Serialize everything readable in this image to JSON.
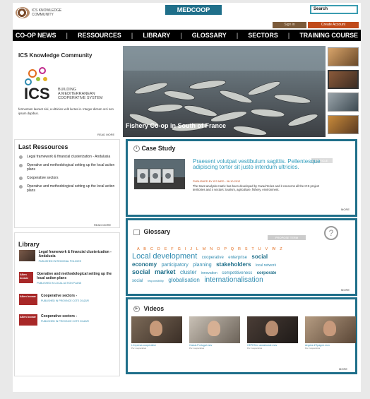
{
  "header": {
    "logo_text": "ICS KNOWLEDGE COMMUNITY",
    "brand_tab": "MEDCOOP",
    "search_label": "Search",
    "sign_in": "Sign in",
    "create_account": "Create Account"
  },
  "nav": [
    {
      "label": "CO-OP NEWS"
    },
    {
      "label": "RESSOURCES"
    },
    {
      "label": "LIBRARY"
    },
    {
      "label": "GLOSSARY"
    },
    {
      "label": "SECTORS"
    },
    {
      "label": "TRAINING COURSE"
    }
  ],
  "ics": {
    "title": "ICS Knowledge Community",
    "tagline_1": "BUILDING",
    "tagline_2": "A MEDITERRANEAN",
    "tagline_3": "COOPERATIVE SYSTEM",
    "body": "fermentum laoreet nisi, a ultricies velit luctus in. Integer dictum orci non ipsum dapibus.",
    "read_more": "READ MORE"
  },
  "hero": {
    "caption": "Fishery Co-op in South of France"
  },
  "resources": {
    "title": "Last Ressources",
    "items": [
      "Legal framework & financial clusterization - Andalusia",
      "Operative and methodological setting up the local action plans",
      "Cooperative sectors",
      "Operative and methodological setting up the local action plans"
    ],
    "read_more": "READ MORE"
  },
  "library": {
    "title": "Library",
    "items": [
      {
        "title": "Legal framework & financial clusterization - Andalusia",
        "meta": "PUBLISHED IN REGIONAL POLICIES",
        "thumb": ""
      },
      {
        "title": "Operative and methodological setting up the local action plans",
        "meta": "PUBLISHED IN LOCAL ACTION PLANS",
        "thumb": "Allen Iconar"
      },
      {
        "title": "Cooperative sectors -",
        "meta": "PUBLISHED IN PROVINCE COTE D'AZUR",
        "thumb": "Allen Iconar"
      },
      {
        "title": "Cooperative sectors -",
        "meta": "PUBLISHED IN PROVINCE COTE D'AZUR",
        "thumb": "Allen Iconar"
      }
    ]
  },
  "case_study": {
    "title": "Case Study",
    "tag": "ARTICLE",
    "headline": "Praesent volutpat vestibulum sagittis. Pellentesque adipiscing tortor sit justo interdum ultricies.",
    "published": "PUBLISHED BY ICS MED - 06-10-2012",
    "body": "The Swot analysis matrix has been developed by Caraci'teries and it concerns all the ICS project territories and 4 sectors: tourism, agriculture, fishery, environment.",
    "more": "MORE"
  },
  "glossary": {
    "title": "Glossary",
    "tag": "PROPOSE TERM",
    "alphabet": "A B C D E F G I J L M N O P Q R S T U V W Z",
    "cloud": [
      {
        "t": "Local development",
        "s": 11,
        "c": "#2f8bb0"
      },
      {
        "t": "cooperative",
        "s": 6,
        "c": "#2f8bb0"
      },
      {
        "t": "enterprise",
        "s": 6,
        "c": "#2f8bb0"
      },
      {
        "t": "social",
        "s": 8,
        "c": "#1f6f8a",
        "b": true
      },
      {
        "t": "economy",
        "s": 8,
        "c": "#1f6f8a",
        "b": true
      },
      {
        "t": "participatory",
        "s": 7,
        "c": "#2f8bb0"
      },
      {
        "t": "planning",
        "s": 7,
        "c": "#2f8bb0"
      },
      {
        "t": "stakeholders",
        "s": 8,
        "c": "#1f6f8a",
        "b": true
      },
      {
        "t": "local network",
        "s": 5,
        "c": "#2f8bb0"
      },
      {
        "t": "social",
        "s": 9,
        "c": "#1f6f8a",
        "b": true
      },
      {
        "t": "market",
        "s": 9,
        "c": "#1f6f8a",
        "b": true
      },
      {
        "t": "cluster",
        "s": 8,
        "c": "#2f8bb0"
      },
      {
        "t": "innovation",
        "s": 5,
        "c": "#2f8bb0"
      },
      {
        "t": "competitiveness",
        "s": 6,
        "c": "#2f8bb0"
      },
      {
        "t": "corporate",
        "s": 6,
        "c": "#1f6f8a",
        "b": true
      },
      {
        "t": "social",
        "s": 6,
        "c": "#2f8bb0"
      },
      {
        "t": "responsibility",
        "s": 4,
        "c": "#2f8bb0"
      },
      {
        "t": "globalisation",
        "s": 8,
        "c": "#2f8bb0"
      },
      {
        "t": "internationalisation",
        "s": 10,
        "c": "#2f8bb0"
      }
    ],
    "more": "MORE"
  },
  "videos": {
    "title": "Videos",
    "items": [
      {
        "title": "L'impresa cooperative",
        "sub": "Per cooperativa"
      },
      {
        "title": "Caixal-Portugal.mov",
        "sub": "Per cooperativa"
      },
      {
        "title": "CEPES-in andalousie.mov",
        "sub": "Per cooperativa"
      },
      {
        "title": "Angela d'Epagne.mov",
        "sub": "Per cooperativa"
      }
    ],
    "more": "MORE"
  }
}
